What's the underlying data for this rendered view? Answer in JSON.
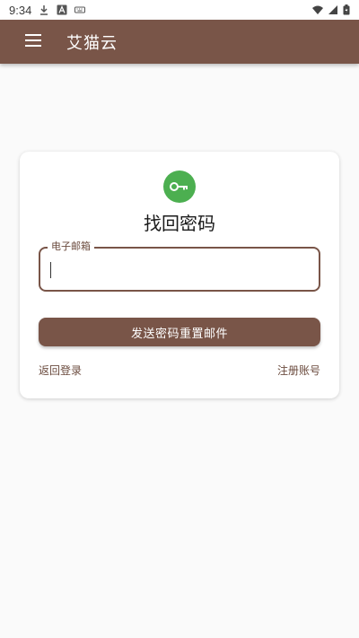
{
  "status_bar": {
    "time": "9:34",
    "icons": [
      "download-icon",
      "font-a-icon",
      "keyboard-icon",
      "wifi-icon",
      "signal-icon",
      "battery-icon"
    ]
  },
  "app_bar": {
    "title": "艾猫云",
    "menu_icon": "hamburger-menu-icon"
  },
  "card": {
    "icon": "key-icon",
    "title": "找回密码",
    "email_field": {
      "label": "电子邮箱",
      "value": ""
    },
    "submit_label": "发送密码重置邮件",
    "back_login_label": "返回登录",
    "register_label": "注册账号"
  },
  "colors": {
    "primary": "#795548",
    "key_badge": "#4caf50",
    "background": "#fafafa",
    "card": "#ffffff"
  }
}
